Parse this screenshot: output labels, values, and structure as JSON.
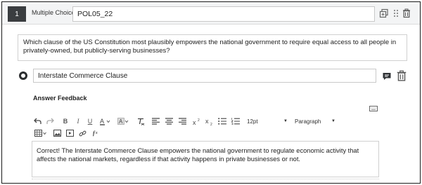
{
  "question": {
    "number": "1",
    "type_label": "Multiple Choice",
    "name": "POL05_22",
    "text": "Which clause of the US Constitution most plausibly empowers the national government to require equal access to all people in privately-owned, but publicly-serving businesses?"
  },
  "answer": {
    "text": "Interstate Commerce Clause",
    "feedback_label": "Answer Feedback"
  },
  "editor": {
    "font_size": "12pt",
    "block_format": "Paragraph",
    "content": "Correct! The Interstate Commerce Clause empowers the national government to regulate economic activity that affects the national markets, regardless if that activity happens in private businesses or not."
  },
  "icons": {
    "header": [
      "copy-icon",
      "drag-handle-icon",
      "trash-icon"
    ],
    "answer": [
      "comment-icon",
      "trash-icon"
    ],
    "toolbar": [
      "undo-icon",
      "redo-icon",
      "bold-icon",
      "italic-icon",
      "underline-icon",
      "text-color-icon",
      "background-color-icon",
      "clear-formatting-icon",
      "align-left-icon",
      "align-center-icon",
      "align-right-icon",
      "superscript-icon",
      "subscript-icon",
      "bullet-list-icon",
      "numbered-list-icon",
      "table-icon",
      "image-icon",
      "media-icon",
      "link-icon",
      "math-icon",
      "keyboard-icon"
    ]
  }
}
